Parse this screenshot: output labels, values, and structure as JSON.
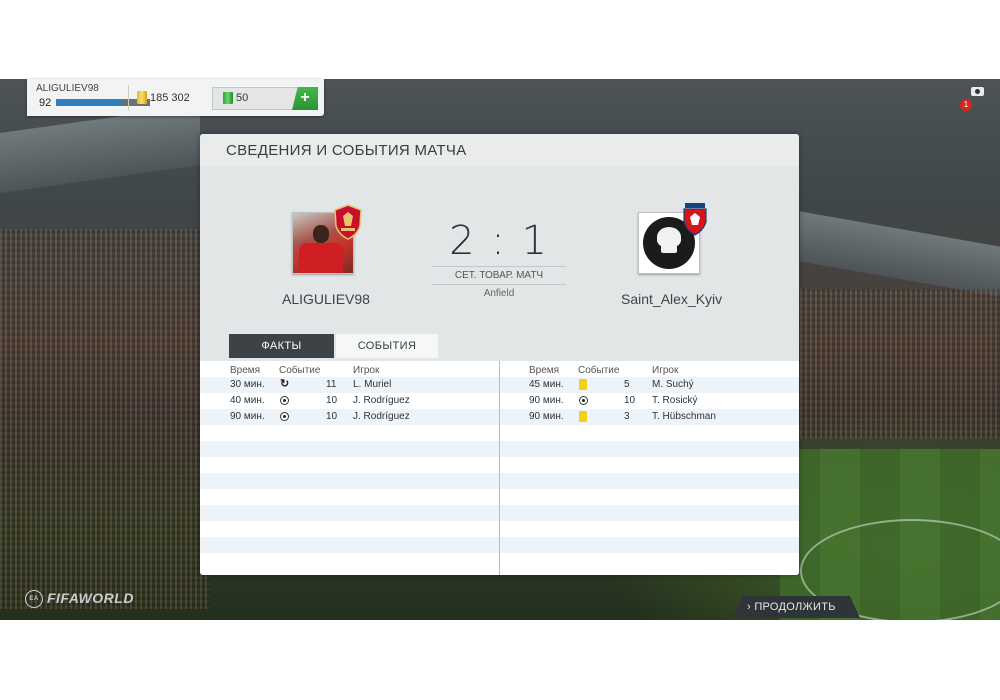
{
  "topbar": {
    "username": "ALIGULIEV98",
    "level": "92",
    "level_progress_percent": 70,
    "coins": "185 302",
    "points": "50",
    "add_label": "+"
  },
  "notifications": {
    "count": "1"
  },
  "panel": {
    "title": "СВЕДЕНИЯ И СОБЫТИЯ МАТЧА",
    "home_team": "ALIGULIEV98",
    "away_team": "Saint_Alex_Kyiv",
    "score": "2 : 1",
    "match_type": "СЕТ. ТОВАР. МАТЧ",
    "venue": "Anfield",
    "tabs": {
      "facts": "ФАКТЫ",
      "events": "СОБЫТИЯ"
    },
    "columns": {
      "time": "Время",
      "event": "Событие",
      "player": "Игрок"
    },
    "home_events": [
      {
        "time": "30 мин.",
        "event_icon": "substitution-icon",
        "number": "11",
        "player": "L. Muriel"
      },
      {
        "time": "40 мин.",
        "event_icon": "goal-ball-icon",
        "number": "10",
        "player": "J. Rodríguez"
      },
      {
        "time": "90 мин.",
        "event_icon": "goal-ball-icon",
        "number": "10",
        "player": "J. Rodríguez"
      }
    ],
    "away_events": [
      {
        "time": "45 мин.",
        "event_icon": "yellow-card-icon",
        "number": "5",
        "player": "M. Suchý"
      },
      {
        "time": "90 мин.",
        "event_icon": "goal-ball-icon",
        "number": "10",
        "player": "T. Rosický"
      },
      {
        "time": "90 мин.",
        "event_icon": "yellow-card-icon",
        "number": "3",
        "player": "T. Hübschman"
      }
    ]
  },
  "footer": {
    "logo_text": "FIFAWORLD",
    "continue_label": "› ПРОДОЛЖИТЬ"
  },
  "colors": {
    "accent_blue": "#2e7ec4",
    "accent_green": "#2a9333",
    "tab_active": "#3d4246",
    "notification_red": "#d9261c"
  }
}
